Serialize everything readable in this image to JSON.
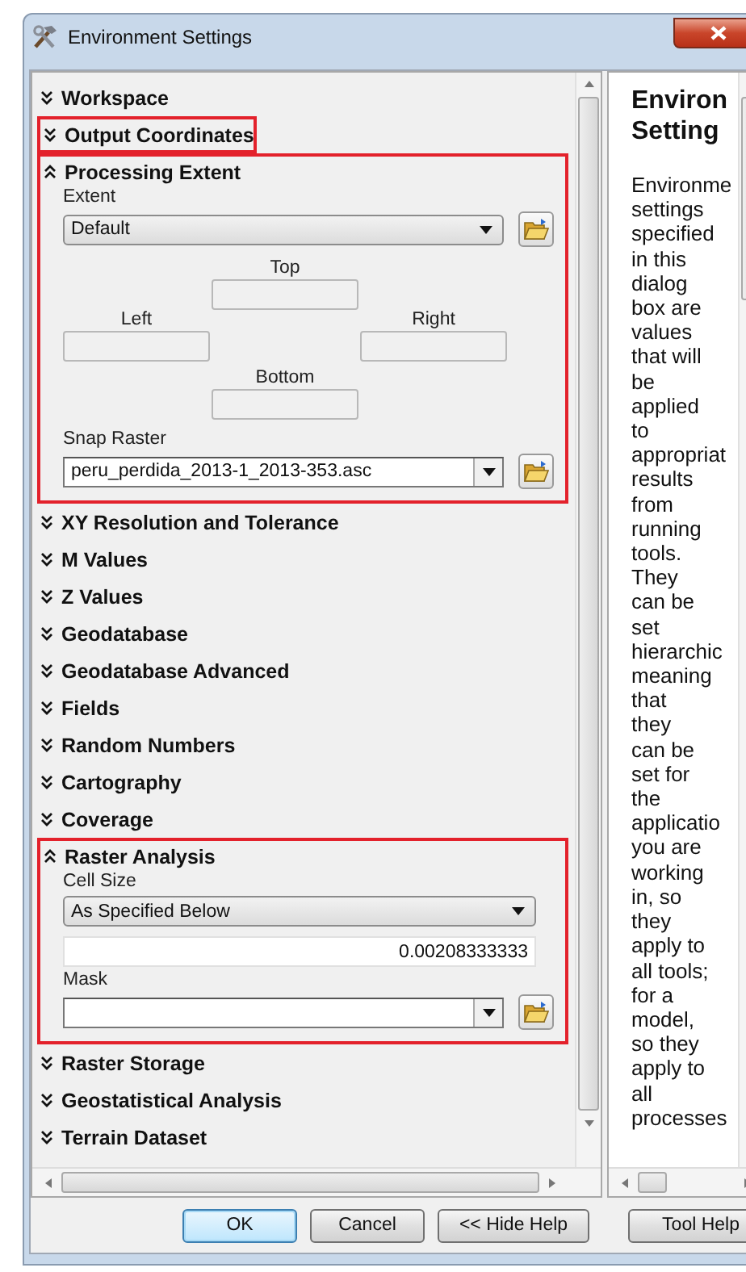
{
  "window": {
    "title": "Environment Settings"
  },
  "sections": [
    {
      "title": "Workspace",
      "expanded": false,
      "highlighted": false
    },
    {
      "title": "Output Coordinates",
      "expanded": false,
      "highlighted": true
    },
    {
      "title": "Processing Extent",
      "expanded": true,
      "highlighted": true,
      "fields": [
        {
          "kind": "dropdown",
          "label": "Extent",
          "value": "Default",
          "browse": true
        },
        {
          "kind": "extent",
          "top": "Top",
          "left": "Left",
          "right": "Right",
          "bottom": "Bottom"
        },
        {
          "kind": "combo",
          "label": "Snap Raster",
          "value": "peru_perdida_2013-1_2013-353.asc",
          "browse": true
        }
      ]
    },
    {
      "title": "XY Resolution and Tolerance",
      "expanded": false,
      "highlighted": false
    },
    {
      "title": "M Values",
      "expanded": false,
      "highlighted": false
    },
    {
      "title": "Z Values",
      "expanded": false,
      "highlighted": false
    },
    {
      "title": "Geodatabase",
      "expanded": false,
      "highlighted": false
    },
    {
      "title": "Geodatabase Advanced",
      "expanded": false,
      "highlighted": false
    },
    {
      "title": "Fields",
      "expanded": false,
      "highlighted": false
    },
    {
      "title": "Random Numbers",
      "expanded": false,
      "highlighted": false
    },
    {
      "title": "Cartography",
      "expanded": false,
      "highlighted": false
    },
    {
      "title": "Coverage",
      "expanded": false,
      "highlighted": false
    },
    {
      "title": "Raster Analysis",
      "expanded": true,
      "highlighted": true,
      "fields": [
        {
          "kind": "dropdown",
          "label": "Cell Size",
          "value": "As Specified Below",
          "browse": false
        },
        {
          "kind": "number",
          "value": "0.00208333333"
        },
        {
          "kind": "combo",
          "label": "Mask",
          "browse": true
        }
      ]
    },
    {
      "title": "Raster Storage",
      "expanded": false,
      "highlighted": false
    },
    {
      "title": "Geostatistical Analysis",
      "expanded": false,
      "highlighted": false
    },
    {
      "title": "Terrain Dataset",
      "expanded": false,
      "highlighted": false
    }
  ],
  "help": {
    "heading": [
      "Environ",
      "Setting"
    ],
    "lines": [
      "Environme",
      "settings",
      "specified",
      "in this",
      "dialog",
      "box are",
      "values",
      "that will",
      "be",
      "applied",
      "to",
      "appropriat",
      "results",
      "from",
      "running",
      "tools.",
      "They",
      "can be",
      "set",
      "hierarchic",
      "meaning",
      "that",
      "they",
      "can be",
      "set for",
      "the",
      "applicatio",
      "you are",
      "working",
      "in, so",
      "they",
      "apply to",
      "all tools;",
      "for a",
      "model,",
      "so they",
      "apply to",
      "all",
      "processes"
    ],
    "button": "Tool Help"
  },
  "buttons": [
    {
      "label": "OK",
      "default": true
    },
    {
      "label": "Cancel",
      "default": false
    },
    {
      "label": "<< Hide Help",
      "default": false
    }
  ]
}
